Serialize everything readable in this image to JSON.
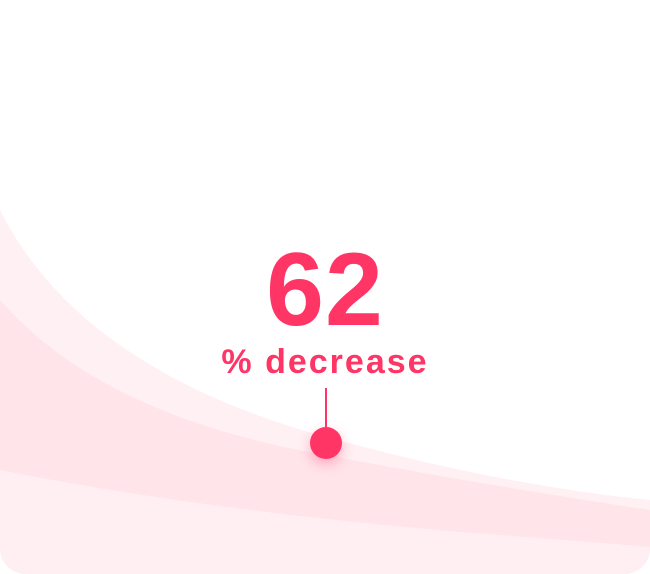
{
  "stat": {
    "value": "62",
    "label": "% decrease"
  },
  "colors": {
    "accent": "#ff3566",
    "wave_light": "#fff0f3",
    "wave_mid": "#ffe1e8",
    "wave_strong": "#ffd2dd",
    "background": "#ffffff"
  }
}
